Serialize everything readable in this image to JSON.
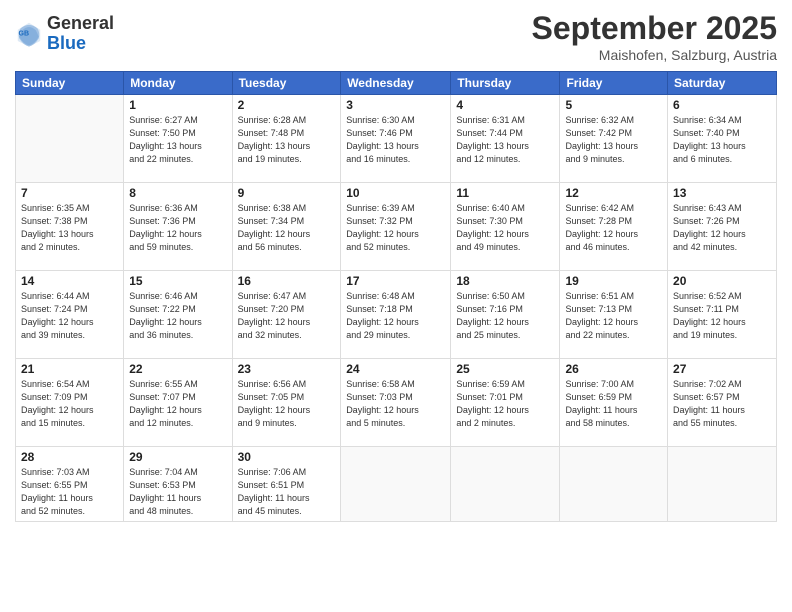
{
  "header": {
    "logo_general": "General",
    "logo_blue": "Blue",
    "month_title": "September 2025",
    "location": "Maishofen, Salzburg, Austria"
  },
  "days_of_week": [
    "Sunday",
    "Monday",
    "Tuesday",
    "Wednesday",
    "Thursday",
    "Friday",
    "Saturday"
  ],
  "weeks": [
    [
      {
        "day": "",
        "info": ""
      },
      {
        "day": "1",
        "info": "Sunrise: 6:27 AM\nSunset: 7:50 PM\nDaylight: 13 hours\nand 22 minutes."
      },
      {
        "day": "2",
        "info": "Sunrise: 6:28 AM\nSunset: 7:48 PM\nDaylight: 13 hours\nand 19 minutes."
      },
      {
        "day": "3",
        "info": "Sunrise: 6:30 AM\nSunset: 7:46 PM\nDaylight: 13 hours\nand 16 minutes."
      },
      {
        "day": "4",
        "info": "Sunrise: 6:31 AM\nSunset: 7:44 PM\nDaylight: 13 hours\nand 12 minutes."
      },
      {
        "day": "5",
        "info": "Sunrise: 6:32 AM\nSunset: 7:42 PM\nDaylight: 13 hours\nand 9 minutes."
      },
      {
        "day": "6",
        "info": "Sunrise: 6:34 AM\nSunset: 7:40 PM\nDaylight: 13 hours\nand 6 minutes."
      }
    ],
    [
      {
        "day": "7",
        "info": "Sunrise: 6:35 AM\nSunset: 7:38 PM\nDaylight: 13 hours\nand 2 minutes."
      },
      {
        "day": "8",
        "info": "Sunrise: 6:36 AM\nSunset: 7:36 PM\nDaylight: 12 hours\nand 59 minutes."
      },
      {
        "day": "9",
        "info": "Sunrise: 6:38 AM\nSunset: 7:34 PM\nDaylight: 12 hours\nand 56 minutes."
      },
      {
        "day": "10",
        "info": "Sunrise: 6:39 AM\nSunset: 7:32 PM\nDaylight: 12 hours\nand 52 minutes."
      },
      {
        "day": "11",
        "info": "Sunrise: 6:40 AM\nSunset: 7:30 PM\nDaylight: 12 hours\nand 49 minutes."
      },
      {
        "day": "12",
        "info": "Sunrise: 6:42 AM\nSunset: 7:28 PM\nDaylight: 12 hours\nand 46 minutes."
      },
      {
        "day": "13",
        "info": "Sunrise: 6:43 AM\nSunset: 7:26 PM\nDaylight: 12 hours\nand 42 minutes."
      }
    ],
    [
      {
        "day": "14",
        "info": "Sunrise: 6:44 AM\nSunset: 7:24 PM\nDaylight: 12 hours\nand 39 minutes."
      },
      {
        "day": "15",
        "info": "Sunrise: 6:46 AM\nSunset: 7:22 PM\nDaylight: 12 hours\nand 36 minutes."
      },
      {
        "day": "16",
        "info": "Sunrise: 6:47 AM\nSunset: 7:20 PM\nDaylight: 12 hours\nand 32 minutes."
      },
      {
        "day": "17",
        "info": "Sunrise: 6:48 AM\nSunset: 7:18 PM\nDaylight: 12 hours\nand 29 minutes."
      },
      {
        "day": "18",
        "info": "Sunrise: 6:50 AM\nSunset: 7:16 PM\nDaylight: 12 hours\nand 25 minutes."
      },
      {
        "day": "19",
        "info": "Sunrise: 6:51 AM\nSunset: 7:13 PM\nDaylight: 12 hours\nand 22 minutes."
      },
      {
        "day": "20",
        "info": "Sunrise: 6:52 AM\nSunset: 7:11 PM\nDaylight: 12 hours\nand 19 minutes."
      }
    ],
    [
      {
        "day": "21",
        "info": "Sunrise: 6:54 AM\nSunset: 7:09 PM\nDaylight: 12 hours\nand 15 minutes."
      },
      {
        "day": "22",
        "info": "Sunrise: 6:55 AM\nSunset: 7:07 PM\nDaylight: 12 hours\nand 12 minutes."
      },
      {
        "day": "23",
        "info": "Sunrise: 6:56 AM\nSunset: 7:05 PM\nDaylight: 12 hours\nand 9 minutes."
      },
      {
        "day": "24",
        "info": "Sunrise: 6:58 AM\nSunset: 7:03 PM\nDaylight: 12 hours\nand 5 minutes."
      },
      {
        "day": "25",
        "info": "Sunrise: 6:59 AM\nSunset: 7:01 PM\nDaylight: 12 hours\nand 2 minutes."
      },
      {
        "day": "26",
        "info": "Sunrise: 7:00 AM\nSunset: 6:59 PM\nDaylight: 11 hours\nand 58 minutes."
      },
      {
        "day": "27",
        "info": "Sunrise: 7:02 AM\nSunset: 6:57 PM\nDaylight: 11 hours\nand 55 minutes."
      }
    ],
    [
      {
        "day": "28",
        "info": "Sunrise: 7:03 AM\nSunset: 6:55 PM\nDaylight: 11 hours\nand 52 minutes."
      },
      {
        "day": "29",
        "info": "Sunrise: 7:04 AM\nSunset: 6:53 PM\nDaylight: 11 hours\nand 48 minutes."
      },
      {
        "day": "30",
        "info": "Sunrise: 7:06 AM\nSunset: 6:51 PM\nDaylight: 11 hours\nand 45 minutes."
      },
      {
        "day": "",
        "info": ""
      },
      {
        "day": "",
        "info": ""
      },
      {
        "day": "",
        "info": ""
      },
      {
        "day": "",
        "info": ""
      }
    ]
  ]
}
